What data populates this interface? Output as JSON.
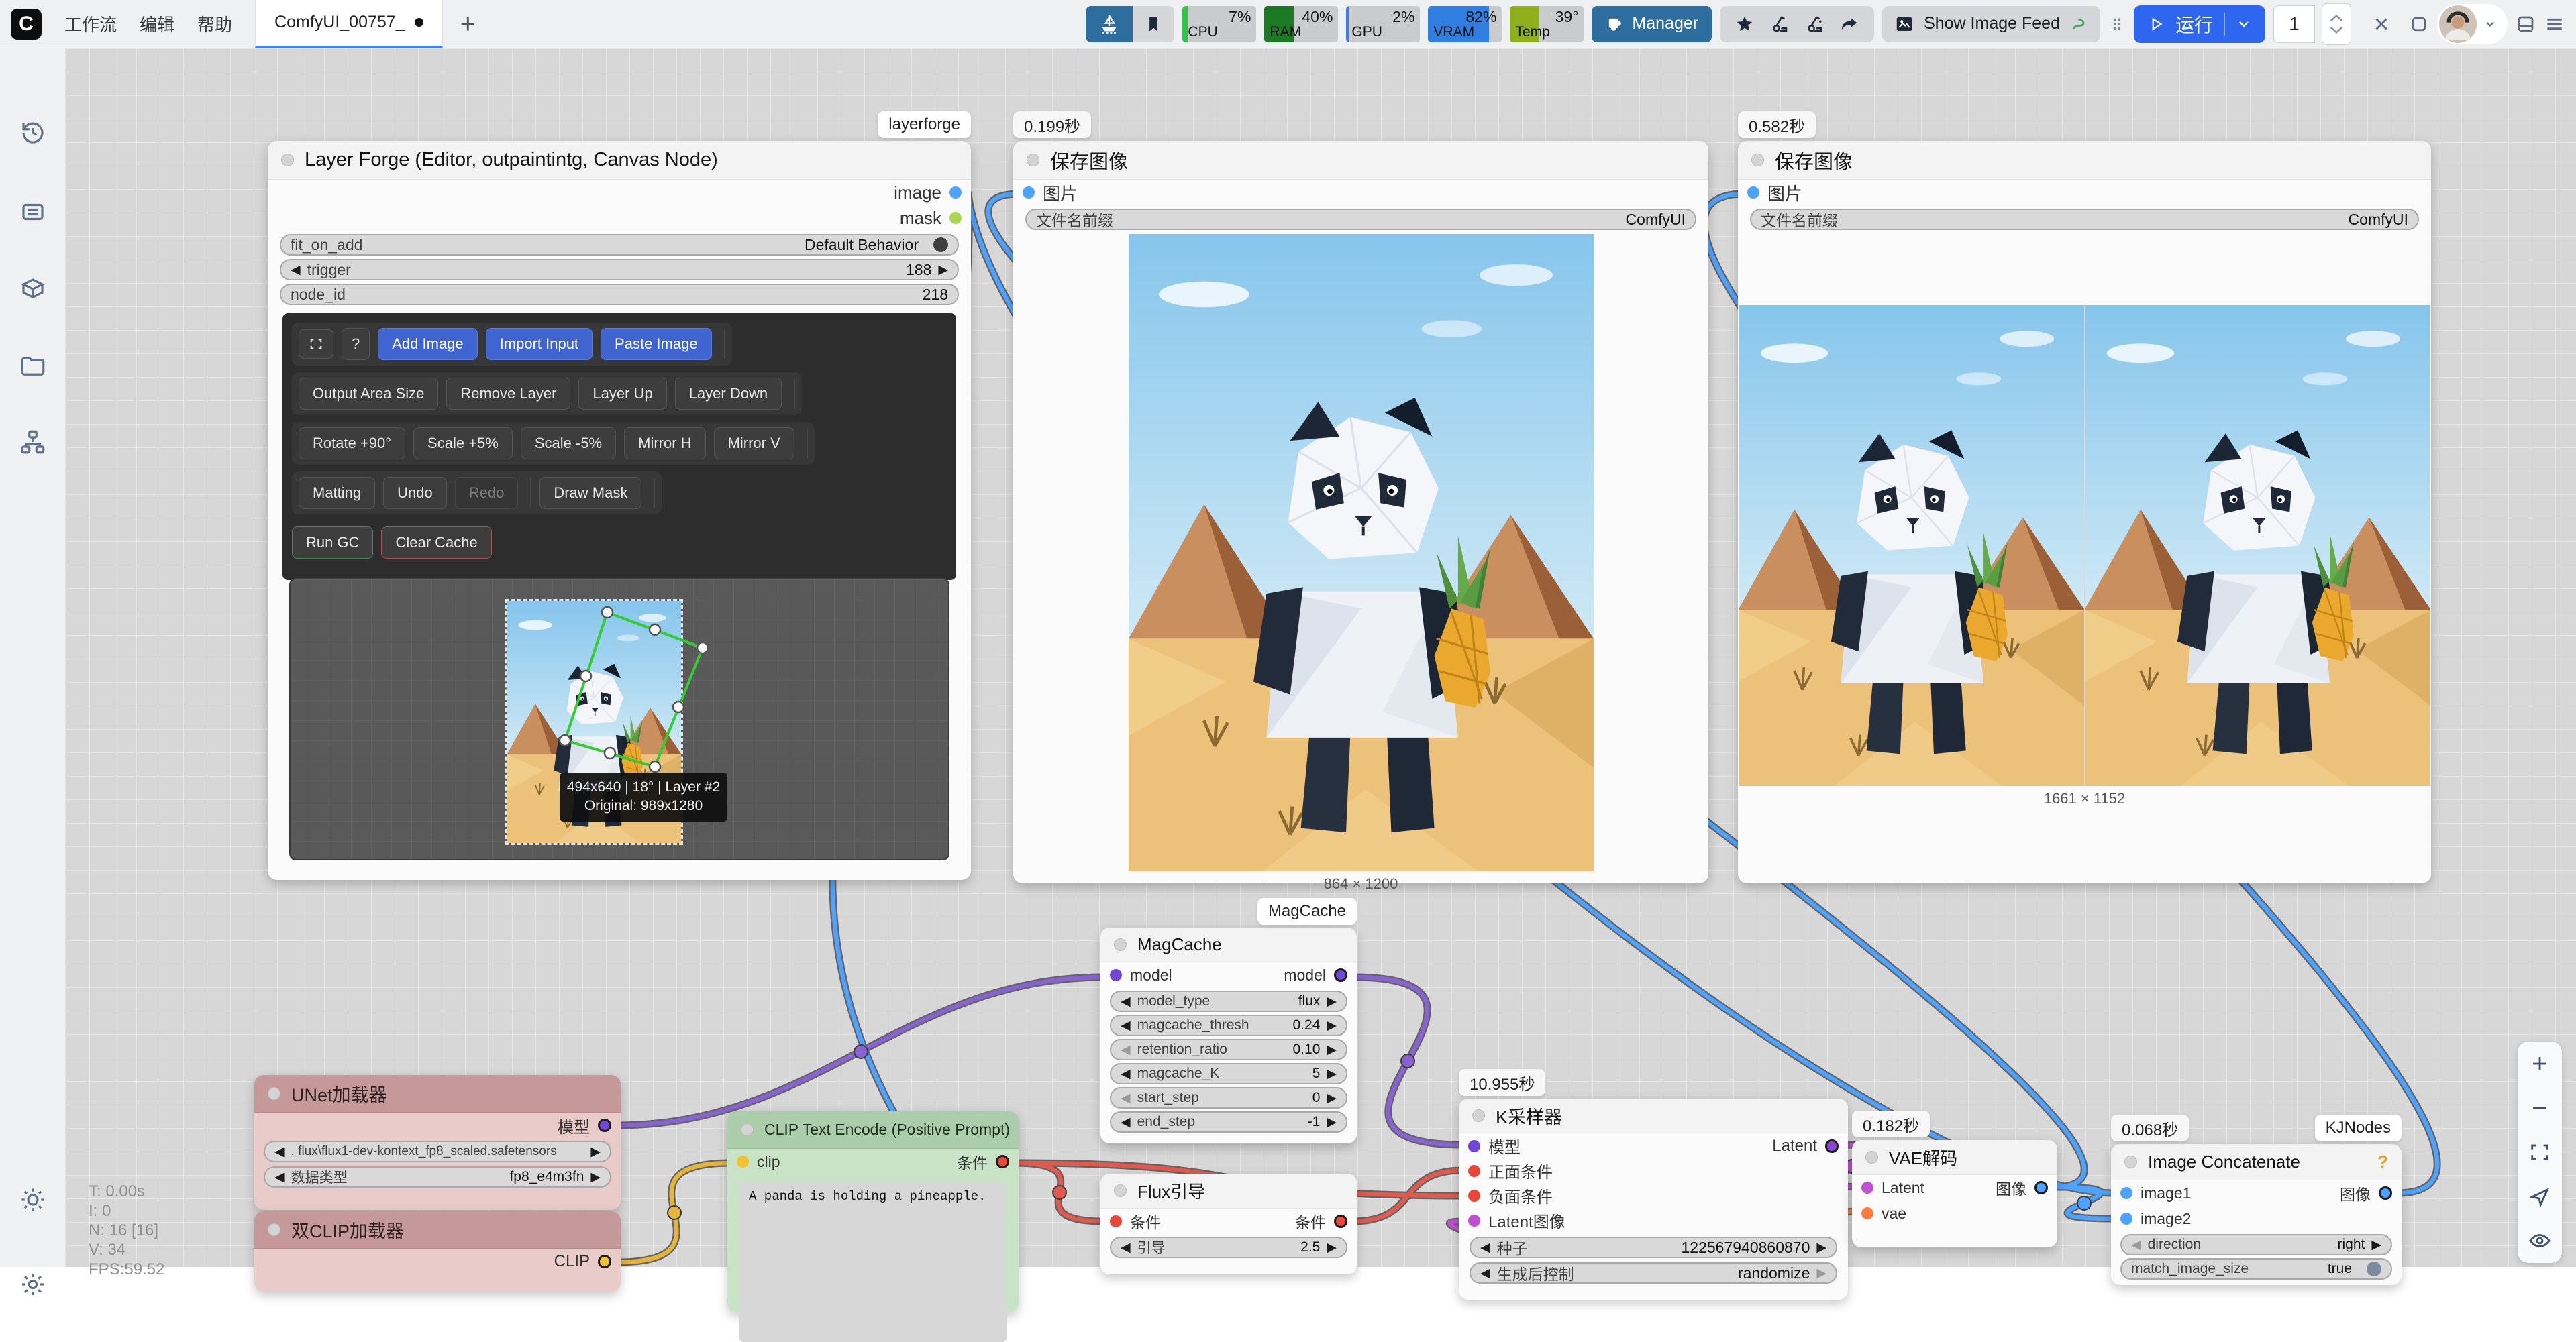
{
  "topbar": {
    "menus": [
      "工作流",
      "编辑",
      "帮助"
    ],
    "tab_label": "ComfyUI_00757_",
    "new_tab": "+",
    "monitors": [
      {
        "label": "CPU",
        "value": "7%",
        "color": "#31c248"
      },
      {
        "label": "RAM",
        "value": "40%",
        "color": "#1d7a24"
      },
      {
        "label": "GPU",
        "value": "2%",
        "color": "#3f7de0"
      },
      {
        "label": "VRAM",
        "value": "82%",
        "color": "#2f7fe0"
      },
      {
        "label": "Temp",
        "value": "39°",
        "color": "#8faf1d"
      }
    ],
    "manager_label": "Manager",
    "show_image_feed_label": "Show Image Feed",
    "run_label": "运行",
    "queue_count": "1"
  },
  "stats": {
    "lines": [
      "T: 0.00s",
      "I: 0",
      "N: 16 [16]",
      "V: 34",
      "FPS:59.52"
    ]
  },
  "layerforge": {
    "badge": "layerforge",
    "title": "Layer Forge (Editor, outpaintintg, Canvas Node)",
    "out_image": "image",
    "out_mask": "mask",
    "w_fit_label": "fit_on_add",
    "w_fit_value": "Default Behavior",
    "w_trigger_label": "trigger",
    "w_trigger_value": "188",
    "w_nodeid_label": "node_id",
    "w_nodeid_value": "218",
    "btn_help": "?",
    "btn_add_image": "Add Image",
    "btn_import_input": "Import Input",
    "btn_paste_image": "Paste Image",
    "btn_output_area": "Output Area Size",
    "btn_remove_layer": "Remove Layer",
    "btn_layer_up": "Layer Up",
    "btn_layer_down": "Layer Down",
    "btn_rotate": "Rotate +90°",
    "btn_scale_up": "Scale +5%",
    "btn_scale_down": "Scale -5%",
    "btn_mirror_h": "Mirror H",
    "btn_mirror_v": "Mirror V",
    "btn_matting": "Matting",
    "btn_undo": "Undo",
    "btn_redo": "Redo",
    "btn_draw_mask": "Draw Mask",
    "btn_run_gc": "Run GC",
    "btn_clear_cache": "Clear Cache",
    "tooltip_line1": "494x640 | 18° | Layer #2",
    "tooltip_line2": "Original: 989x1280"
  },
  "save1": {
    "badge": "0.199秒",
    "title": "保存图像",
    "in_image": "图片",
    "w_label": "文件名前缀",
    "w_value": "ComfyUI",
    "caption": "864 × 1200"
  },
  "save2": {
    "badge": "0.582秒",
    "title": "保存图像",
    "in_image": "图片",
    "w_label": "文件名前缀",
    "w_value": "ComfyUI",
    "caption": "1661 × 1152"
  },
  "magcache": {
    "badge": "MagCache",
    "title": "MagCache",
    "in_model": "model",
    "out_model": "model",
    "w0_label": "model_type",
    "w0_value": "flux",
    "w1_label": "magcache_thresh",
    "w1_value": "0.24",
    "w2_label": "retention_ratio",
    "w2_value": "0.10",
    "w3_label": "magcache_K",
    "w3_value": "5",
    "w4_label": "start_step",
    "w4_value": "0",
    "w5_label": "end_step",
    "w5_value": "-1"
  },
  "fluxguide": {
    "title": "Flux引导",
    "in_cond": "条件",
    "out_cond": "条件",
    "w_label": "引导",
    "w_value": "2.5"
  },
  "ksampler": {
    "badge": "10.955秒",
    "title": "K采样器",
    "in_model": "模型",
    "in_pos": "正面条件",
    "in_neg": "负面条件",
    "in_latent": "Latent图像",
    "out_latent": "Latent",
    "w_seed_label": "种子",
    "w_seed_value": "122567940860870",
    "w_ctrl_label": "生成后控制",
    "w_ctrl_value": "randomize"
  },
  "vaedecode": {
    "badge": "0.182秒",
    "title": "VAE解码",
    "in_latent": "Latent",
    "in_vae": "vae",
    "out_image": "图像"
  },
  "imageconcat": {
    "badge": "0.068秒",
    "type_badge": "KJNodes",
    "title": "Image Concatenate",
    "help": "?",
    "in_image1": "image1",
    "in_image2": "image2",
    "out_image": "图像",
    "w_dir_label": "direction",
    "w_dir_value": "right",
    "w_match_label": "match_image_size",
    "w_match_value": "true"
  },
  "unet": {
    "title": "UNet加载器",
    "out_model": "模型",
    "w0_value": ". flux\\flux1-dev-kontext_fp8_scaled.safetensors",
    "w1_label": "数据类型",
    "w1_value": "fp8_e4m3fn"
  },
  "dualclip": {
    "title": "双CLIP加载器",
    "out_clip": "CLIP"
  },
  "clipencode": {
    "title": "CLIP Text Encode (Positive Prompt)",
    "in_clip": "clip",
    "out_cond": "条件",
    "prompt": "A panda is holding a pineapple."
  },
  "colors": {
    "accent_blue": "#2f66f0",
    "manager_blue": "#2e6e9e",
    "tab_underline": "#3b82f6",
    "link_image": "#4da3ff",
    "link_model": "#8a63d2",
    "link_clip": "#e3b53d",
    "link_cond": "#e05a4e",
    "link_latent": "#c14fd1",
    "link_vae": "#ff7b3d",
    "selection_green": "#33cc33"
  }
}
